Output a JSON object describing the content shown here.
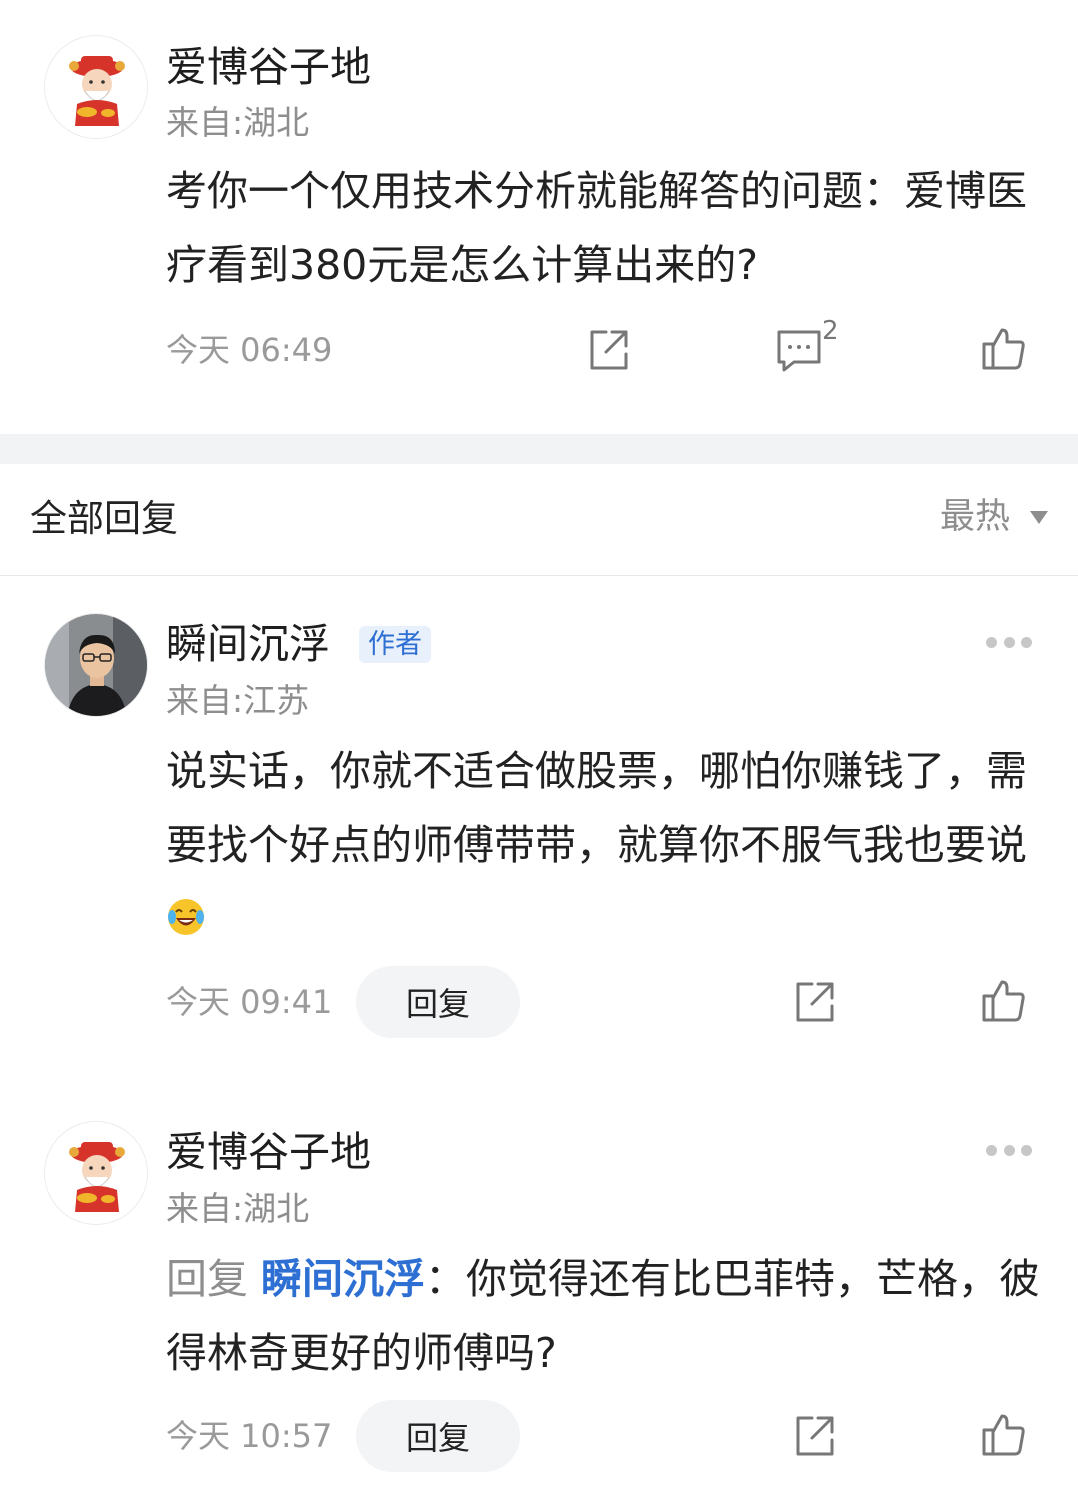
{
  "post": {
    "username": "爱博谷子地",
    "location": "来自:湖北",
    "content": "考你一个仅用技术分析就能解答的问题：爱博医疗看到380元是怎么计算出来的?",
    "time": "今天 06:49",
    "comment_count": "2"
  },
  "replies_section": {
    "title": "全部回复",
    "sort_label": "最热"
  },
  "replies": [
    {
      "username": "瞬间沉浮",
      "badge": "作者",
      "location": "来自:江苏",
      "content": "说实话，你就不适合做股票，哪怕你赚钱了，需要找个好点的师傅带带，就算你不服气我也要说",
      "time": "今天 09:41",
      "reply_label": "回复"
    },
    {
      "username": "爱博谷子地",
      "location": "来自:湖北",
      "reply_prefix": "回复 ",
      "reply_target": "瞬间沉浮",
      "content": "：你觉得还有比巴菲特，芒格，彼得林奇更好的师傅吗?",
      "time": "今天 10:57",
      "reply_label": "回复"
    }
  ],
  "icons": {
    "share": "share-icon",
    "comment": "comment-icon",
    "like": "thumbs-up-icon",
    "more": "more-dots-icon",
    "emoji": "laughing-tears-emoji"
  },
  "colors": {
    "accent": "#2d6fd2",
    "muted": "#8e8e8e",
    "divider": "#f2f3f5"
  }
}
